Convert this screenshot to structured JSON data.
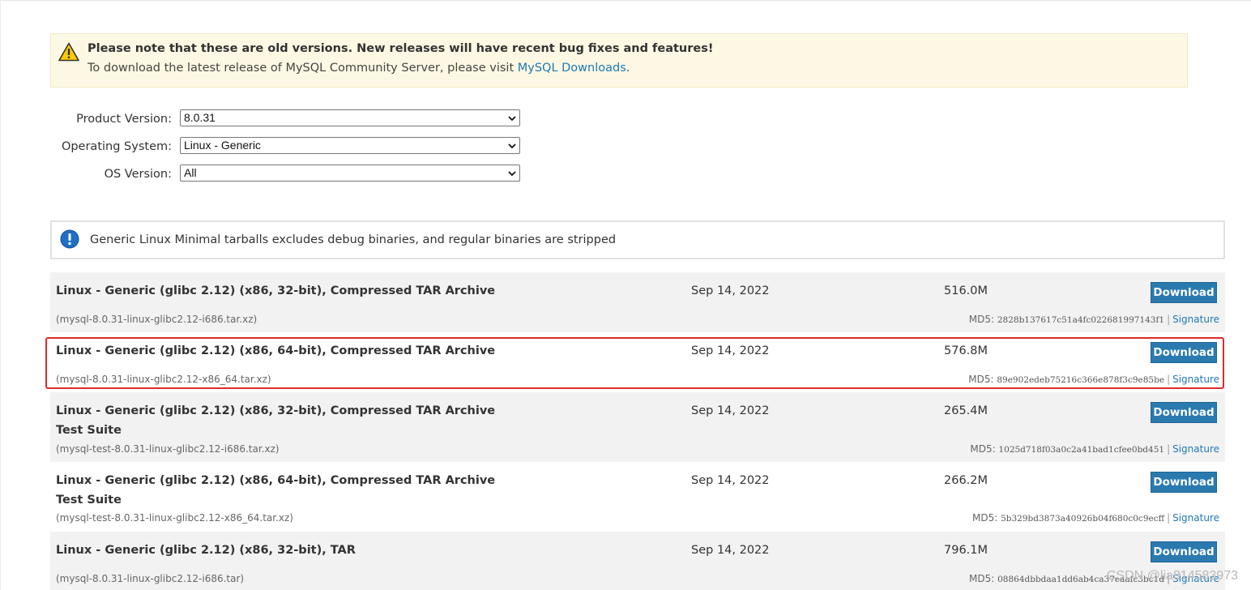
{
  "notice": {
    "heading": "Please note that these are old versions. New releases will have recent bug fixes and features!",
    "text_before": "To download the latest release of MySQL Community Server, please visit ",
    "link_label": "MySQL Downloads",
    "text_after": "."
  },
  "form": {
    "product_version": {
      "label": "Product Version:",
      "value": "8.0.31"
    },
    "operating_system": {
      "label": "Operating System:",
      "value": "Linux - Generic"
    },
    "os_version": {
      "label": "OS Version:",
      "value": "All"
    }
  },
  "info": {
    "text": "Generic Linux Minimal tarballs excludes debug binaries, and regular binaries are stripped"
  },
  "downloads": [
    {
      "name": "Linux - Generic (glibc 2.12) (x86, 32-bit), Compressed TAR Archive",
      "subname": "",
      "file": "(mysql-8.0.31-linux-glibc2.12-i686.tar.xz)",
      "date": "Sep 14, 2022",
      "size": "516.0M",
      "button": "Download",
      "md5_label": "MD5:",
      "md5": "2828b137617c51a4fc022681997143f1",
      "signature": "Signature"
    },
    {
      "name": "Linux - Generic (glibc 2.12) (x86, 64-bit), Compressed TAR Archive",
      "subname": "",
      "file": "(mysql-8.0.31-linux-glibc2.12-x86_64.tar.xz)",
      "date": "Sep 14, 2022",
      "size": "576.8M",
      "button": "Download",
      "md5_label": "MD5:",
      "md5": "89e902edeb75216c366e878f3c9e85be",
      "signature": "Signature"
    },
    {
      "name": "Linux - Generic (glibc 2.12) (x86, 32-bit), Compressed TAR Archive",
      "subname": "Test Suite",
      "file": "(mysql-test-8.0.31-linux-glibc2.12-i686.tar.xz)",
      "date": "Sep 14, 2022",
      "size": "265.4M",
      "button": "Download",
      "md5_label": "MD5:",
      "md5": "1025d718f03a0c2a41bad1cfee0bd451",
      "signature": "Signature"
    },
    {
      "name": "Linux - Generic (glibc 2.12) (x86, 64-bit), Compressed TAR Archive",
      "subname": "Test Suite",
      "file": "(mysql-test-8.0.31-linux-glibc2.12-x86_64.tar.xz)",
      "date": "Sep 14, 2022",
      "size": "266.2M",
      "button": "Download",
      "md5_label": "MD5:",
      "md5": "5b329bd3873a40926b04f680c0c9ecff",
      "signature": "Signature"
    },
    {
      "name": "Linux - Generic (glibc 2.12) (x86, 32-bit), TAR",
      "subname": "",
      "file": "(mysql-8.0.31-linux-glibc2.12-i686.tar)",
      "date": "Sep 14, 2022",
      "size": "796.1M",
      "button": "Download",
      "md5_label": "MD5:",
      "md5": "08864dbbdaa1dd6ab4ca37eaafc3bc1d",
      "signature": "Signature"
    }
  ],
  "watermark": "CSDN @lia814583973",
  "colors": {
    "notice_bg": "#fcf8e3",
    "download_button": "#2a7ab0",
    "link": "#1f78b4",
    "highlight": "#e02a2a"
  }
}
